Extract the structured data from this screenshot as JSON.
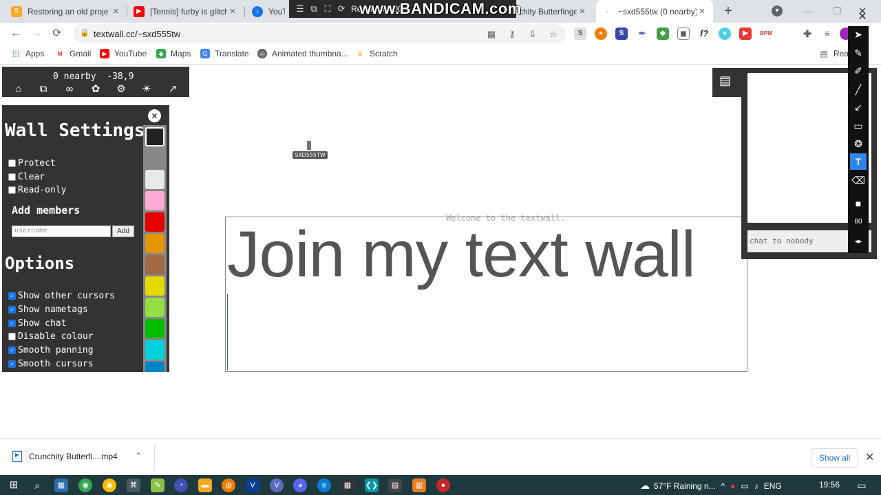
{
  "browser": {
    "tabs": [
      {
        "title": "Restoring an old proje",
        "fav": "scratch-icon",
        "color": "#f9a825"
      },
      {
        "title": "[Tennis] furby is glitch",
        "fav": "youtube-icon",
        "color": "#ff0000"
      },
      {
        "title": "YouTu",
        "fav": "download-icon",
        "color": "#1a73e8"
      },
      {
        "title": "chity Butterfinge",
        "fav": "scratch-icon",
        "color": "#f9a825"
      },
      {
        "title": "~sxd555tw (0 nearby)",
        "fav": "textwall-icon",
        "color": "#888888",
        "active": true
      }
    ],
    "url": "textwall.cc/~sxd555tw",
    "bandicam": {
      "recording_label": "Recording [00",
      "watermark": "www.BANDICAM.com"
    },
    "bookmarks": [
      {
        "label": "Apps",
        "icon": "apps-grid-icon",
        "color": "#4285f4"
      },
      {
        "label": "Gmail",
        "icon": "gmail-icon",
        "color": "#ea4335"
      },
      {
        "label": "YouTube",
        "icon": "youtube-icon",
        "color": "#ff0000"
      },
      {
        "label": "Maps",
        "icon": "maps-icon",
        "color": "#34a853"
      },
      {
        "label": "Translate",
        "icon": "translate-icon",
        "color": "#4285f4"
      },
      {
        "label": "Animated thumbna...",
        "icon": "globe-icon",
        "color": "#5f6368"
      },
      {
        "label": "Scratch",
        "icon": "scratch-icon",
        "color": "#f9a825"
      }
    ],
    "reading_list": "Rea"
  },
  "textwall": {
    "coords": "0 nearby  -38,9",
    "settings": {
      "title": "Wall Settings",
      "wall_checks": [
        {
          "label": "Protect",
          "checked": false
        },
        {
          "label": "Clear",
          "checked": false
        },
        {
          "label": "Read-only",
          "checked": false
        }
      ],
      "add_members_title": "Add members",
      "username_placeholder": "username",
      "add_label": "Add",
      "options_title": "Options",
      "options": [
        {
          "label": "Show other cursors",
          "checked": true
        },
        {
          "label": "Show nametags",
          "checked": true
        },
        {
          "label": "Show chat",
          "checked": true
        },
        {
          "label": "Disable colour",
          "checked": false
        },
        {
          "label": "Smooth panning",
          "checked": true
        },
        {
          "label": "Smooth cursors",
          "checked": true
        }
      ],
      "palette": [
        "#222222",
        "#888888",
        "#e8e8e8",
        "#ffaad4",
        "#e60000",
        "#e59500",
        "#a06a42",
        "#e5d900",
        "#94e044",
        "#02be01",
        "#00d3dd",
        "#0083c7"
      ]
    },
    "nametag": "SXD555TW",
    "welcome": "Welcome to the textwall.",
    "big_text": "Join my text wall",
    "chat_placeholder": "chat to nobody",
    "brush_size": "80"
  },
  "downloads": {
    "file": "Crunchity Butterfi....mp4",
    "show_all": "Show all"
  },
  "taskbar": {
    "weather": "57°F  Raining n...",
    "lang": "ENG",
    "time": "19:56"
  }
}
